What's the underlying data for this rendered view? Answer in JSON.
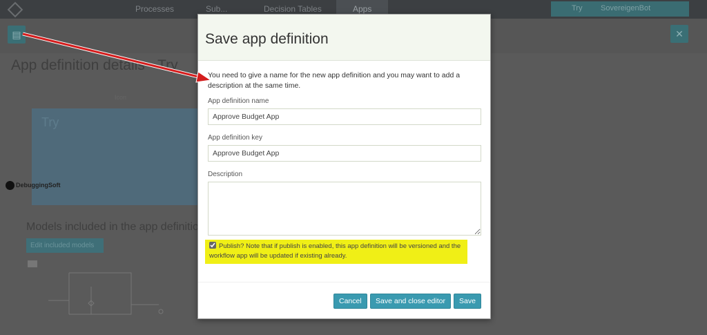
{
  "background": {
    "nav": {
      "items": [
        "Processes",
        "Sub...",
        "Decision Tables",
        "Apps"
      ],
      "active": "Apps",
      "user_prefix": "Try",
      "user_name": "SovereigenBot"
    },
    "page_title": "App definition details - Try",
    "card_title": "Try",
    "caption": "Icon",
    "models_heading": "Models included in the app definition",
    "badge_label": "Edit included models",
    "watermark": "DebuggingSoft"
  },
  "modal": {
    "title": "Save app definition",
    "intro": "You need to give a name for the new app definition and you may want to add a description at the same time.",
    "name_label": "App definition name",
    "name_value": "Approve Budget App",
    "key_label": "App definition key",
    "key_value": "Approve Budget App",
    "description_label": "Description",
    "description_value": "",
    "publish_checked": true,
    "publish_text": "Publish? Note that if publish is enabled, this app definition will be versioned and the workflow app will be updated if existing already.",
    "buttons": {
      "cancel": "Cancel",
      "save_close": "Save and close editor",
      "save": "Save"
    }
  },
  "colors": {
    "accent": "#3a9ab0",
    "highlight": "#f0ef16",
    "arrow": "#d41e1e"
  }
}
